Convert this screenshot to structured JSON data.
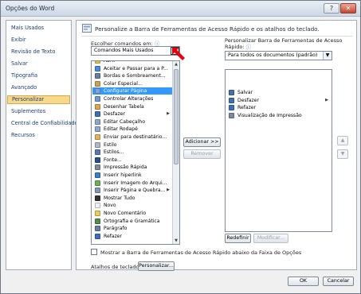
{
  "window": {
    "title": "Opções do Word",
    "help_glyph": "?",
    "close_glyph": "✕"
  },
  "nav": {
    "items": [
      {
        "label": "Mais Usados",
        "selected": false
      },
      {
        "label": "Exibir",
        "selected": false
      },
      {
        "label": "Revisão de Texto",
        "selected": false
      },
      {
        "label": "Salvar",
        "selected": false
      },
      {
        "label": "Tipografia",
        "selected": false
      },
      {
        "label": "Avançado",
        "selected": false
      },
      {
        "label": "Personalizar",
        "selected": true
      },
      {
        "label": "Suplementos",
        "selected": false
      },
      {
        "label": "Central de Confiabilidade",
        "selected": false
      },
      {
        "label": "Recursos",
        "selected": false
      }
    ]
  },
  "header": {
    "text": "Personalize a Barra de Ferramentas de Acesso Rápido e os atalhos do teclado."
  },
  "left": {
    "label": "Escolher comandos em:",
    "info_glyph": "ⓘ",
    "combo_value": "Comandos Mais Usados",
    "combo_arrow": "▼",
    "items": [
      {
        "label": "Abrir",
        "icon": "folder-icon",
        "submenu": false,
        "selected": false
      },
      {
        "label": "Aceitar e Passar para a P...",
        "icon": "accept-icon",
        "submenu": false,
        "selected": false
      },
      {
        "label": "Bordas e Sombreament...",
        "icon": "borders-icon",
        "submenu": false,
        "selected": false
      },
      {
        "label": "Colar Especial...",
        "icon": "paste-icon",
        "submenu": false,
        "selected": false
      },
      {
        "label": "Configurar Página",
        "icon": "page-setup-icon",
        "submenu": false,
        "selected": true
      },
      {
        "label": "Controlar Alterações",
        "icon": "track-changes-icon",
        "submenu": false,
        "selected": false
      },
      {
        "label": "Desenhar Tabela",
        "icon": "draw-table-icon",
        "submenu": false,
        "selected": false
      },
      {
        "label": "Desfazer",
        "icon": "undo-icon",
        "submenu": true,
        "selected": false
      },
      {
        "label": "Editar Cabeçalho",
        "icon": "header-icon",
        "submenu": false,
        "selected": false
      },
      {
        "label": "Editar Rodapé",
        "icon": "footer-icon",
        "submenu": false,
        "selected": false
      },
      {
        "label": "Enviar para destinatário...",
        "icon": "send-icon",
        "submenu": false,
        "selected": false
      },
      {
        "label": "Estilo",
        "icon": "style-icon",
        "submenu": false,
        "selected": false
      },
      {
        "label": "Estilos...",
        "icon": "styles-icon",
        "submenu": false,
        "selected": false
      },
      {
        "label": "Fonte...",
        "icon": "font-icon",
        "submenu": false,
        "selected": false
      },
      {
        "label": "Impressão Rápida",
        "icon": "quick-print-icon",
        "submenu": false,
        "selected": false
      },
      {
        "label": "Inserir hiperlink",
        "icon": "hyperlink-icon",
        "submenu": false,
        "selected": false
      },
      {
        "label": "Inserir Imagem do Arqui...",
        "icon": "picture-icon",
        "submenu": false,
        "selected": false
      },
      {
        "label": "Inserir Página e Quebra...",
        "icon": "page-break-icon",
        "submenu": true,
        "selected": false
      },
      {
        "label": "Mostrar Tudo",
        "icon": "pilcrow-icon",
        "submenu": false,
        "selected": false
      },
      {
        "label": "Novo",
        "icon": "new-doc-icon",
        "submenu": false,
        "selected": false
      },
      {
        "label": "Novo Comentário",
        "icon": "comment-icon",
        "submenu": false,
        "selected": false
      },
      {
        "label": "Ortografia e Gramática",
        "icon": "spelling-icon",
        "submenu": false,
        "selected": false
      },
      {
        "label": "Parágrafo",
        "icon": "paragraph-icon",
        "submenu": false,
        "selected": false
      },
      {
        "label": "Refazer",
        "icon": "redo-icon",
        "submenu": false,
        "selected": false
      }
    ]
  },
  "middle": {
    "add_label": "Adicionar >>",
    "remove_label": "Remover"
  },
  "right": {
    "label": "Personalizar Barra de Ferramentas de Acesso Rápido:",
    "info_glyph": "ⓘ",
    "combo_value": "Para todos os documentos (padrão)",
    "combo_arrow": "▼",
    "items": [
      {
        "label": "Salvar",
        "icon": "save-icon",
        "submenu": false
      },
      {
        "label": "Desfazer",
        "icon": "undo-icon",
        "submenu": true
      },
      {
        "label": "Refazer",
        "icon": "redo-icon",
        "submenu": false
      },
      {
        "label": "Visualização de Impressão",
        "icon": "print-preview-icon",
        "submenu": false
      }
    ],
    "reset_label": "Redefinir",
    "modify_label": "Modificar...",
    "move_up_glyph": "▲",
    "move_down_glyph": "▼"
  },
  "bottom": {
    "checkbox_label": "Mostrar a Barra de Ferramentas de Acesso Rápido abaixo da Faixa de Opções",
    "shortcuts_label": "Atalhos de teclado:",
    "customize_label": "Personalizar..."
  },
  "footer": {
    "ok_label": "OK",
    "cancel_label": "Cancelar"
  },
  "colors": {
    "selection": "#3399ff",
    "nav_selected": "#f8d98c",
    "annotation_arrow": "#e8000b"
  }
}
